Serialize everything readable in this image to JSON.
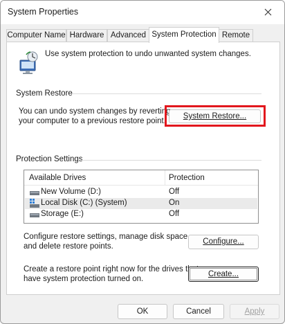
{
  "window": {
    "title": "System Properties"
  },
  "tabs": [
    {
      "label": "Computer Name",
      "active": false
    },
    {
      "label": "Hardware",
      "active": false
    },
    {
      "label": "Advanced",
      "active": false
    },
    {
      "label": "System Protection",
      "active": true
    },
    {
      "label": "Remote",
      "active": false
    }
  ],
  "intro": {
    "text": "Use system protection to undo unwanted system changes."
  },
  "system_restore": {
    "group_label": "System Restore",
    "description_line1": "You can undo system changes by reverting",
    "description_line2": "your computer to a previous restore point.",
    "button_label": "System Restore..."
  },
  "protection": {
    "group_label": "Protection Settings",
    "columns": [
      "Available Drives",
      "Protection"
    ],
    "drives": [
      {
        "name": "New Volume (D:)",
        "protection": "Off",
        "icon": "drive-icon",
        "selected": false
      },
      {
        "name": "Local Disk (C:) (System)",
        "protection": "On",
        "icon": "system-drive-icon",
        "selected": true
      },
      {
        "name": "Storage (E:)",
        "protection": "Off",
        "icon": "drive-icon",
        "selected": false
      }
    ],
    "configure_line1": "Configure restore settings, manage disk space,",
    "configure_line2": "and delete restore points.",
    "configure_label": "Configure...",
    "create_line1": "Create a restore point right now for the drives that",
    "create_line2": "have system protection turned on.",
    "create_label": "Create..."
  },
  "footer": {
    "ok_label": "OK",
    "cancel_label": "Cancel",
    "apply_label": "Apply"
  },
  "colors": {
    "highlight": "#e2171d",
    "selected_row": "#eaeaea"
  }
}
